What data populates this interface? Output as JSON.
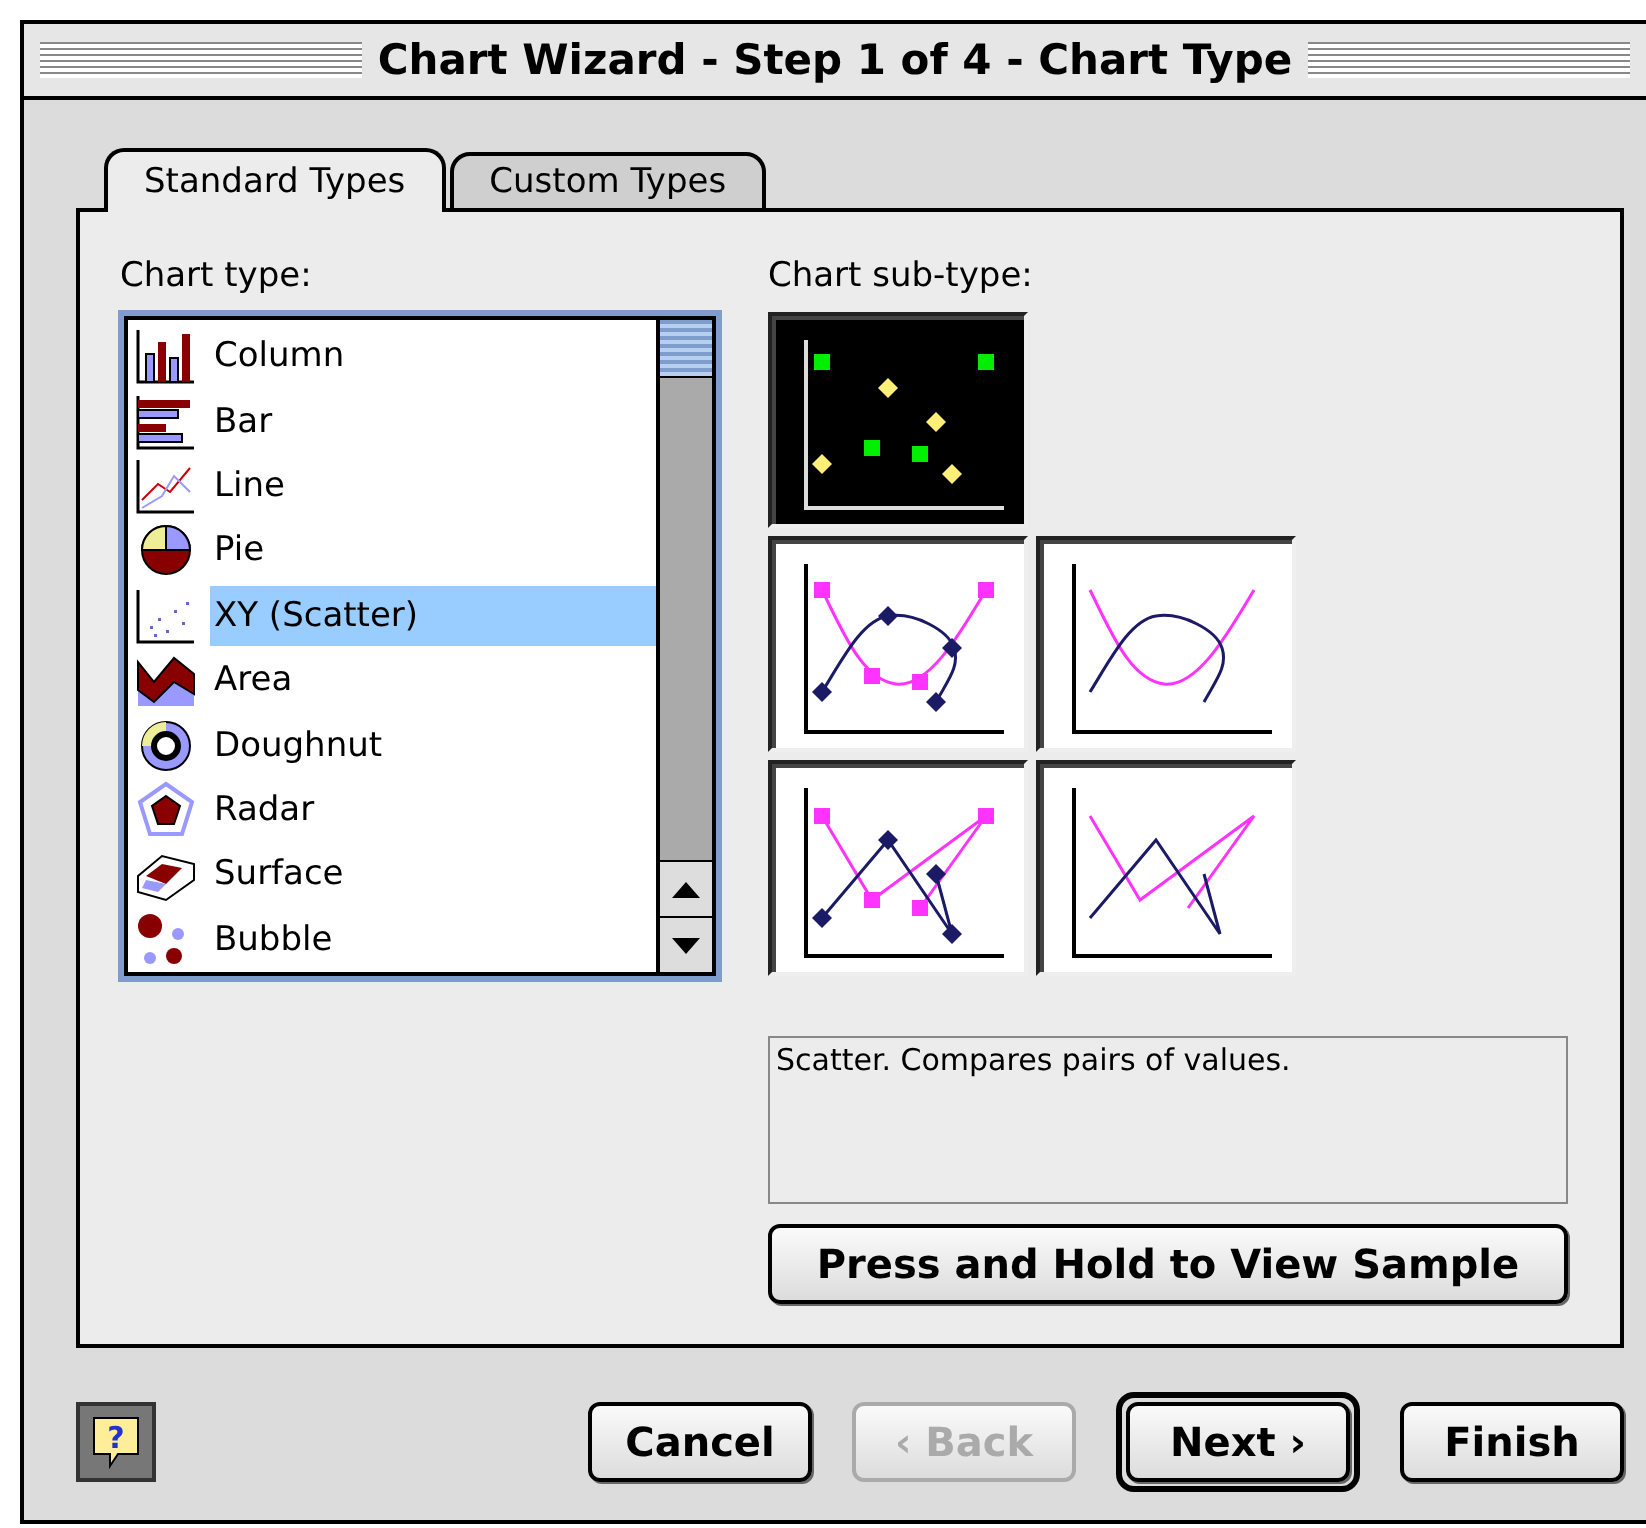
{
  "window": {
    "title": "Chart Wizard - Step 1 of 4 - Chart Type"
  },
  "tabs": [
    {
      "label": "Standard Types",
      "selected": true
    },
    {
      "label": "Custom Types",
      "selected": false
    }
  ],
  "chart_type": {
    "label": "Chart type:",
    "items": [
      {
        "label": "Column",
        "kind": "column",
        "selected": false
      },
      {
        "label": "Bar",
        "kind": "bar",
        "selected": false
      },
      {
        "label": "Line",
        "kind": "line",
        "selected": false
      },
      {
        "label": "Pie",
        "kind": "pie",
        "selected": false
      },
      {
        "label": "XY (Scatter)",
        "kind": "scatter",
        "selected": true
      },
      {
        "label": "Area",
        "kind": "area",
        "selected": false
      },
      {
        "label": "Doughnut",
        "kind": "doughnut",
        "selected": false
      },
      {
        "label": "Radar",
        "kind": "radar",
        "selected": false
      },
      {
        "label": "Surface",
        "kind": "surface",
        "selected": false
      },
      {
        "label": "Bubble",
        "kind": "bubble",
        "selected": false
      }
    ]
  },
  "chart_sub_type": {
    "label": "Chart sub-type:",
    "items": [
      {
        "kind": "markers",
        "selected": true
      },
      {
        "kind": "smooth-markers",
        "selected": false
      },
      {
        "kind": "smooth-lines",
        "selected": false
      },
      {
        "kind": "lines-markers",
        "selected": false
      },
      {
        "kind": "lines",
        "selected": false
      }
    ]
  },
  "description": "Scatter. Compares pairs of values.",
  "help_button": "?",
  "sample_button": "Press and Hold to View Sample",
  "buttons": [
    {
      "label": "Cancel",
      "disabled": false,
      "default": false
    },
    {
      "label": "‹ Back",
      "disabled": true,
      "default": false
    },
    {
      "label": "Next ›",
      "disabled": false,
      "default": true
    },
    {
      "label": "Finish",
      "disabled": false,
      "default": false
    }
  ]
}
